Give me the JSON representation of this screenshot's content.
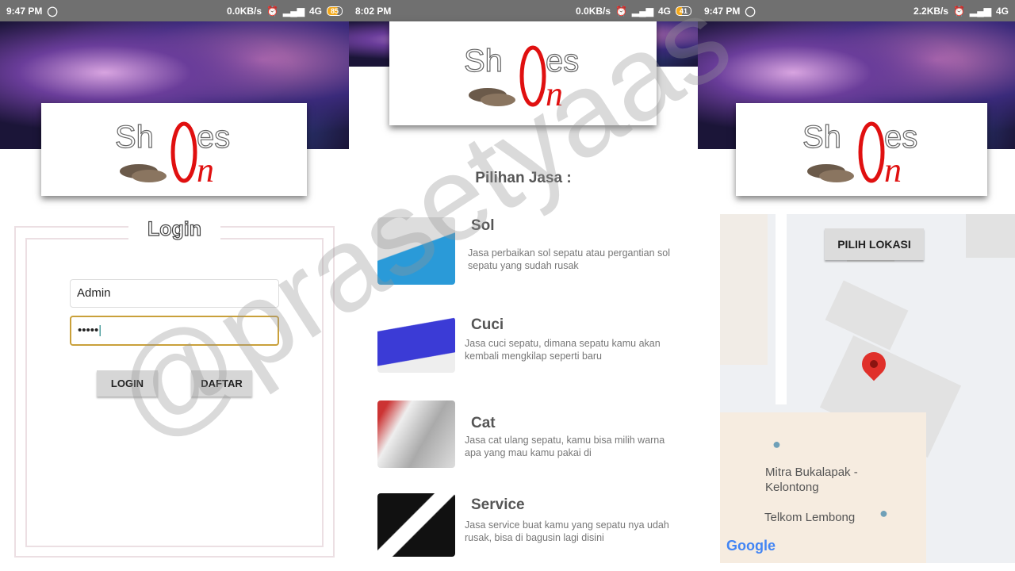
{
  "screens": [
    {
      "status": {
        "time": "9:47 PM",
        "speed": "0.0KB/s",
        "network": "4G",
        "battery": "85"
      }
    },
    {
      "status": {
        "time": "8:02 PM",
        "speed": "0.0KB/s",
        "network": "4G",
        "battery": "41"
      }
    },
    {
      "status": {
        "time": "9:47 PM",
        "speed": "2.2KB/s",
        "network": "4G"
      }
    }
  ],
  "logo": {
    "text_top": "Sh",
    "text_o": "0",
    "text_es": "es",
    "text_n": "n"
  },
  "login": {
    "title": "Login",
    "username": "Admin",
    "password": "•••••",
    "login_button": "LOGIN",
    "register_button": "DAFTAR"
  },
  "services": {
    "title": "Pilihan Jasa :",
    "items": [
      {
        "name": "Sol",
        "desc": "Jasa perbaikan sol sepatu atau pergantian sol sepatu yang sudah rusak",
        "color": "#2a9ad8"
      },
      {
        "name": "Cuci",
        "desc": "Jasa cuci sepatu, dimana sepatu kamu akan kembali mengkilap seperti baru",
        "color": "#3b3bd6"
      },
      {
        "name": "Cat",
        "desc": "Jasa cat ulang sepatu, kamu bisa milih warna apa yang mau kamu pakai di",
        "color": "#c8c8c8"
      },
      {
        "name": "Service",
        "desc": "Jasa service buat kamu yang sepatu nya udah rusak, bisa di bagusin lagi disini",
        "color": "#222222"
      }
    ]
  },
  "map": {
    "pick_button": "PILIH LOKASI",
    "place1": "Mitra Bukalapak - Kelontong",
    "place2": "Telkom Lembong",
    "google": "Google"
  },
  "watermark": "@prasetyaas"
}
